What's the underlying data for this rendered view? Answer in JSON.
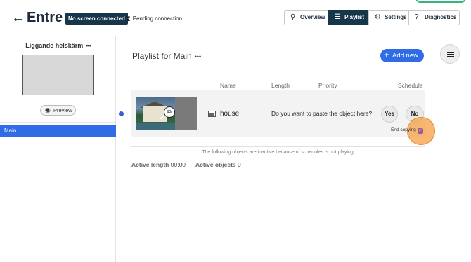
{
  "header": {
    "back_icon": "arrow-left-icon",
    "title": "Entre",
    "badge": "No screen connected",
    "pending": "Pending connection",
    "nav": {
      "overview": "Overview",
      "playlist": "Playlist",
      "settings": "Settings",
      "diagnostics": "Diagnostics"
    }
  },
  "sidebar": {
    "screen_name": "Liggande helskärm",
    "dots": "•••",
    "preview": "Preview",
    "selected_item": "Main"
  },
  "playlist": {
    "title": "Playlist for Main",
    "dots": "•••",
    "add_new": "Add new",
    "columns": {
      "name": "Name",
      "length": "Length",
      "priority": "Priority",
      "schedule": "Schedule"
    },
    "rows": [
      {
        "name": "house",
        "question": "Do you want to paste the object here?",
        "yes": "Yes",
        "no": "No",
        "end_copying": "End copying"
      }
    ],
    "inactive_note": "The following objects are inactive because of schedules is not playing",
    "active_length_label": "Active length",
    "active_length_value": "00:00",
    "active_objects_label": "Active objects",
    "active_objects_value": "0"
  },
  "colors": {
    "primary": "#2f6ce5",
    "dark": "#173649",
    "highlight": "#f5a046"
  }
}
